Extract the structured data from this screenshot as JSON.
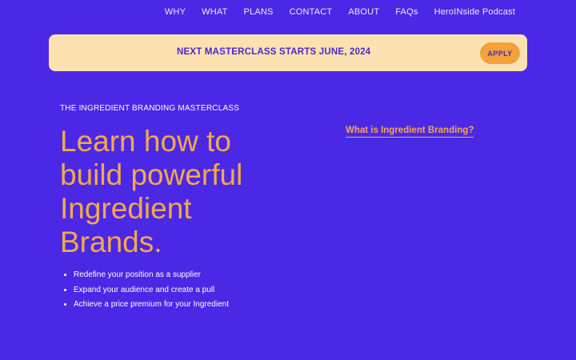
{
  "nav": {
    "items": [
      "WHY",
      "WHAT",
      "PLANS",
      "CONTACT",
      "ABOUT",
      "FAQs",
      "HeroINside Podcast"
    ]
  },
  "banner": {
    "text": "NEXT MASTERCLASS STARTS JUNE, 2024",
    "apply_label": "APPLY"
  },
  "hero": {
    "eyebrow": "THE INGREDIENT BRANDING MASTERCLASS",
    "headline": "Learn how to build powerful Ingredient Brands.",
    "bullets": [
      "Redefine your position as a supplier",
      "Expand your audience and create a pull",
      "Achieve a price premium for your Ingredient"
    ],
    "side_link": "What is Ingredient Branding?"
  },
  "colors": {
    "background": "#4b28e6",
    "banner": "#fde2b1",
    "accent": "#f5a94a",
    "button": "#f3a23c"
  }
}
